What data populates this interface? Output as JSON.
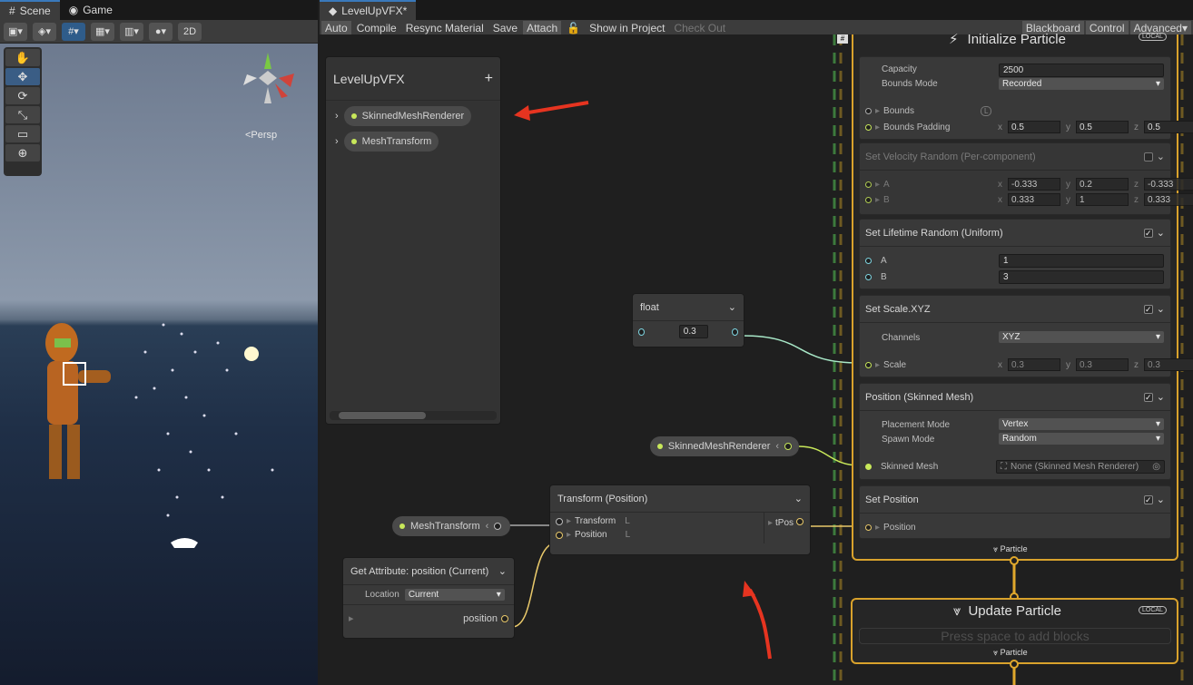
{
  "scene_tabs": [
    {
      "label": "Scene"
    },
    {
      "label": "Game"
    }
  ],
  "scene_toolbar": {
    "mode_2d": "2D",
    "persp_label": "<Persp"
  },
  "vfx_tab": "LevelUpVFX*",
  "vfx_toolbar": {
    "auto": "Auto",
    "compile": "Compile",
    "resync": "Resync Material",
    "save": "Save",
    "attach": "Attach",
    "show_in_project": "Show in Project",
    "check_out": "Check Out",
    "blackboard": "Blackboard",
    "control": "Control",
    "advanced": "Advanced"
  },
  "blackboard": {
    "title": "LevelUpVFX",
    "add": "+",
    "items": [
      {
        "label": "SkinnedMeshRenderer"
      },
      {
        "label": "MeshTransform"
      }
    ]
  },
  "float_node": {
    "title": "float",
    "value": "0.3"
  },
  "skinned_pill": {
    "label": "SkinnedMeshRenderer"
  },
  "mesh_pill": {
    "label": "MeshTransform"
  },
  "transform_node": {
    "title": "Transform (Position)",
    "ports": [
      "Transform",
      "Position"
    ],
    "out": "tPos"
  },
  "get_attr": {
    "title": "Get Attribute: position (Current)",
    "location_label": "Location",
    "location_value": "Current",
    "out": "position"
  },
  "initialize": {
    "title": "Initialize Particle",
    "badge": "LOCAL",
    "capacity_label": "Capacity",
    "capacity": "2500",
    "bounds_mode_label": "Bounds Mode",
    "bounds_mode": "Recorded",
    "bounds_label": "Bounds",
    "bounds_padding_label": "Bounds Padding",
    "bp_x": "0.5",
    "bp_y": "0.5",
    "bp_z": "0.5",
    "flow_out": "Particle"
  },
  "blocks": {
    "velocity": {
      "title": "Set Velocity Random (Per-component)",
      "a_label": "A",
      "b_label": "B",
      "a": [
        "-0.333",
        "0.2",
        "-0.333"
      ],
      "b": [
        "0.333",
        "1",
        "0.333"
      ]
    },
    "lifetime": {
      "title": "Set Lifetime Random (Uniform)",
      "a_label": "A",
      "b_label": "B",
      "a": "1",
      "b": "3"
    },
    "scale": {
      "title": "Set Scale.XYZ",
      "channels_label": "Channels",
      "channels": "XYZ",
      "scale_label": "Scale",
      "v": [
        "0.3",
        "0.3",
        "0.3"
      ]
    },
    "skinned": {
      "title": "Position (Skinned Mesh)",
      "placement_label": "Placement Mode",
      "placement": "Vertex",
      "spawn_label": "Spawn Mode",
      "spawn": "Random",
      "mesh_label": "Skinned Mesh",
      "mesh_value": "None (Skinned Mesh Renderer)"
    },
    "setpos": {
      "title": "Set Position",
      "pos_label": "Position"
    }
  },
  "update": {
    "title": "Update Particle",
    "badge": "LOCAL",
    "hint": "Press space to add blocks",
    "flow_out": "Particle"
  },
  "axis": {
    "x": "x",
    "y": "y",
    "z": "z",
    "l": "L"
  }
}
